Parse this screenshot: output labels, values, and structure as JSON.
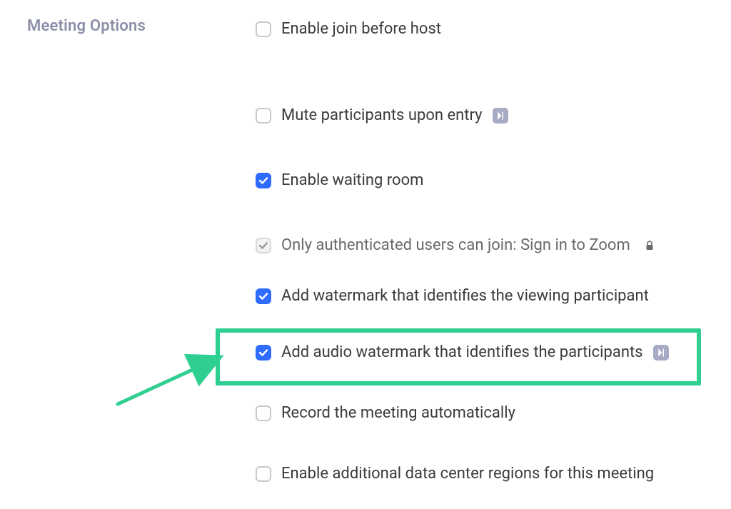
{
  "section": {
    "title": "Meeting Options"
  },
  "options": {
    "items": [
      {
        "label": "Enable join before host",
        "state": "unchecked",
        "badge": false,
        "lock": false
      },
      {
        "label": "Mute participants upon entry",
        "state": "unchecked",
        "badge": true,
        "lock": false
      },
      {
        "label": "Enable waiting room",
        "state": "checked",
        "badge": false,
        "lock": false
      },
      {
        "label": "Only authenticated users can join: Sign in to Zoom",
        "state": "disabled-checked",
        "badge": false,
        "lock": true
      },
      {
        "label": "Add watermark that identifies the viewing participant",
        "state": "checked",
        "badge": false,
        "lock": false
      },
      {
        "label": "Add audio watermark that identifies the participants",
        "state": "checked",
        "badge": true,
        "lock": false
      },
      {
        "label": "Record the meeting automatically",
        "state": "unchecked",
        "badge": false,
        "lock": false
      },
      {
        "label": "Enable additional data center regions for this meeting",
        "state": "unchecked",
        "badge": false,
        "lock": false
      }
    ]
  }
}
